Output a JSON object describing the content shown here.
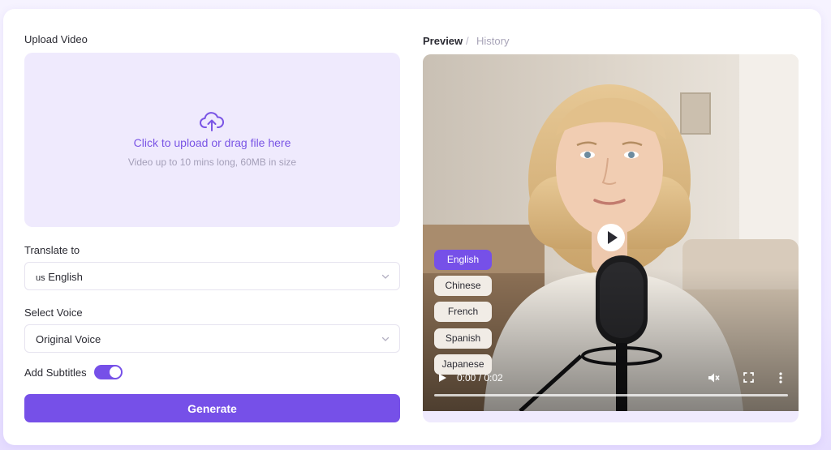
{
  "upload": {
    "section_label": "Upload Video",
    "title": "Click to upload or drag file here",
    "hint": "Video up to 10 mins long, 60MB in size"
  },
  "translate": {
    "label": "Translate to",
    "flag": "us",
    "value": "English"
  },
  "voice": {
    "label": "Select Voice",
    "value": "Original Voice"
  },
  "subtitles": {
    "label": "Add Subtitles",
    "enabled": true
  },
  "generate_label": "Generate",
  "tabs": {
    "preview": "Preview",
    "separator": "/",
    "history": "History"
  },
  "video": {
    "languages": [
      "English",
      "Chinese",
      "French",
      "Spanish",
      "Japanese"
    ],
    "active_language": "English",
    "time": "0:00 / 0:02",
    "progress": 0
  },
  "colors": {
    "accent": "#7650e8",
    "upload_bg": "#efeafd",
    "accent_text": "#7a55e5"
  },
  "icons": [
    "cloud-upload-icon",
    "chevron-down-icon",
    "play-icon",
    "mute-icon",
    "fullscreen-icon",
    "more-icon"
  ]
}
